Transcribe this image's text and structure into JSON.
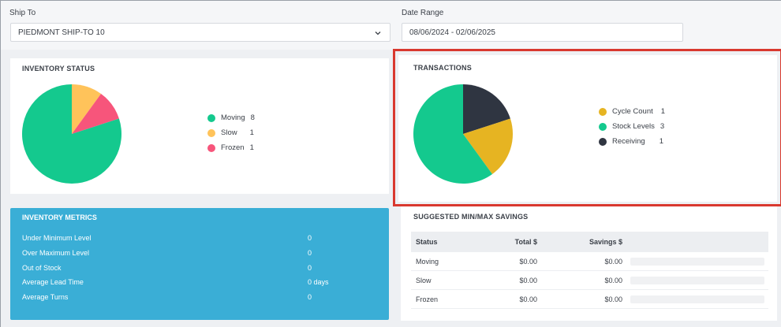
{
  "filters": {
    "ship_to": {
      "label": "Ship To",
      "value": "PIEDMONT SHIP-TO 10"
    },
    "date_range": {
      "label": "Date Range",
      "value": "08/06/2024 - 02/06/2025"
    }
  },
  "inventory_status": {
    "title": "INVENTORY STATUS",
    "legend": [
      {
        "name": "Moving",
        "value": "8",
        "color": "#14c98e"
      },
      {
        "name": "Slow",
        "value": "1",
        "color": "#ffc35a"
      },
      {
        "name": "Frozen",
        "value": "1",
        "color": "#f7557b"
      }
    ]
  },
  "transactions": {
    "title": "TRANSACTIONS",
    "legend": [
      {
        "name": "Cycle Count",
        "value": "1",
        "color": "#e6b422"
      },
      {
        "name": "Stock Levels",
        "value": "3",
        "color": "#14c98e"
      },
      {
        "name": "Receiving",
        "value": "1",
        "color": "#2f3541"
      }
    ]
  },
  "inventory_metrics": {
    "title": "INVENTORY METRICS",
    "rows": [
      {
        "label": "Under Minimum Level",
        "value": "0"
      },
      {
        "label": "Over Maximum Level",
        "value": "0"
      },
      {
        "label": "Out of Stock",
        "value": "0"
      },
      {
        "label": "Average Lead Time",
        "value": "0 days"
      },
      {
        "label": "Average Turns",
        "value": "0"
      }
    ]
  },
  "savings": {
    "title": "SUGGESTED MIN/MAX SAVINGS",
    "headers": {
      "status": "Status",
      "total": "Total $",
      "savings": "Savings $"
    },
    "rows": [
      {
        "status": "Moving",
        "total": "$0.00",
        "savings": "$0.00",
        "fraction": 0
      },
      {
        "status": "Slow",
        "total": "$0.00",
        "savings": "$0.00",
        "fraction": 0
      },
      {
        "status": "Frozen",
        "total": "$0.00",
        "savings": "$0.00",
        "fraction": 0
      }
    ]
  },
  "colors": {
    "accent": "#3aaed6",
    "highlight": "#d9392f"
  }
}
